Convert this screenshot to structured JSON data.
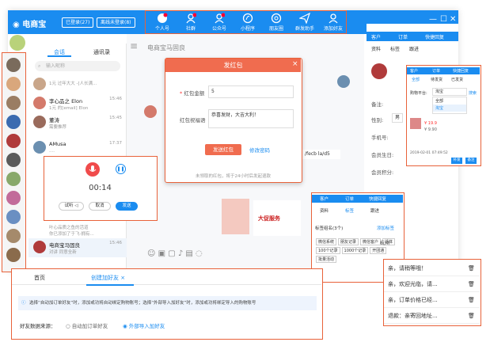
{
  "app": {
    "name": "电商宝",
    "logged_in": "已登录(27)",
    "offline": "离线未登录(8)"
  },
  "nav": [
    {
      "label": "个人号",
      "icon": "chat-icon"
    },
    {
      "label": "社群",
      "icon": "group-icon"
    },
    {
      "label": "公众号",
      "icon": "official-account-icon"
    },
    {
      "label": "小程序",
      "icon": "mini-program-icon"
    },
    {
      "label": "朋友圈",
      "icon": "moments-icon"
    },
    {
      "label": "群发助手",
      "icon": "broadcast-icon"
    },
    {
      "label": "添加好友",
      "icon": "add-friend-icon"
    }
  ],
  "sidebar": {
    "tab_chat": "会话",
    "tab_contacts": "通讯录",
    "search_placeholder": "输入昵称",
    "items": [
      {
        "name": "",
        "preview": "1元 过年大大 -[人长满..."
      },
      {
        "name": "李心品之 Elon",
        "preview": "1元 的[email] Elon",
        "time": "15:46"
      },
      {
        "name": "董涛",
        "preview": "需要推荐",
        "time": "15:45"
      },
      {
        "name": "AMusa",
        "preview": "....",
        "time": "17:37"
      },
      {
        "name": "",
        "preview": "叶心品质之鱼中的最好的"
      },
      {
        "name": "",
        "preview": "叶心品质之鱼的活道"
      },
      {
        "name": "",
        "preview": "你已添加了于飞-拥有..."
      },
      {
        "name": "电商宝马固良",
        "preview": "对讲 同意全新",
        "time": "15:46"
      }
    ]
  },
  "chat": {
    "header": "电商宝马固良",
    "link": "/fecb la/d5",
    "tip": "未领取的红包，将于24小时后发起退款"
  },
  "redpacket": {
    "title": "发红包",
    "amount_label": "红包金额",
    "amount": "5",
    "wish_label": "红包祝福语",
    "wish": "恭喜发财，大吉大利！",
    "send": "发送红包",
    "edit": "修改密码"
  },
  "recorder": {
    "time": "00:14",
    "try_label": "试听 ◁",
    "cancel": "取消",
    "send": "发送"
  },
  "bottom_tabs": {
    "home": "首页",
    "create": "创建加好友",
    "close": "×",
    "notice": "选择“自动加订单好友”时，添加或功将自动绑定购物账号；选择“外部导入加好友”时，添加或功将绑定导入的购物账号",
    "source_label": "好友数据来源：",
    "opt1": "自动加订单好友",
    "opt2": "外部导入加好友"
  },
  "quick_replies": [
    "亲，请稍等哦！",
    "亲，欢迎光临，请...",
    "亲，订单价格已经...",
    "退款：亲寄回地址..."
  ],
  "customer": {
    "tabs": [
      "客户",
      "订单",
      "快捷回复"
    ],
    "subtabs": [
      "资料",
      "标签",
      "跟进"
    ],
    "fields": [
      "备注:",
      "性别:",
      "手机号:",
      "会员生日:",
      "会员积分:"
    ],
    "gender": "男"
  },
  "pop1": {
    "tabs": [
      "客户",
      "订单",
      "快捷回复"
    ],
    "subtabs": [
      "全部",
      "待发货",
      "已发货"
    ],
    "platform_label": "购物平台:",
    "platform": "淘宝",
    "search": "搜索",
    "opts": [
      "全部",
      "淘宝"
    ],
    "order_date": "2019-02-01 07:49:52",
    "amount": "¥ 19.9",
    "a2": "¥ 9.90",
    "btns": [
      "补发",
      "备注"
    ]
  },
  "pop2": {
    "tabs": [
      "客户",
      "订单",
      "快捷回复"
    ],
    "subtabs": [
      "资料",
      "标签",
      "跟进"
    ],
    "tags_label": "标签组名(3个)",
    "add_tag": "添加标签",
    "tags": [
      "微信系统",
      "朋友记录",
      "微信客户",
      "活体",
      "100个记录",
      "1000个记录",
      "开团通",
      "批量活动"
    ],
    "city": "杭州",
    "banner": "大促服务"
  },
  "colors": {
    "brand": "#1a8cf0",
    "highlight": "#e8623a",
    "red": "#f06c4f"
  }
}
